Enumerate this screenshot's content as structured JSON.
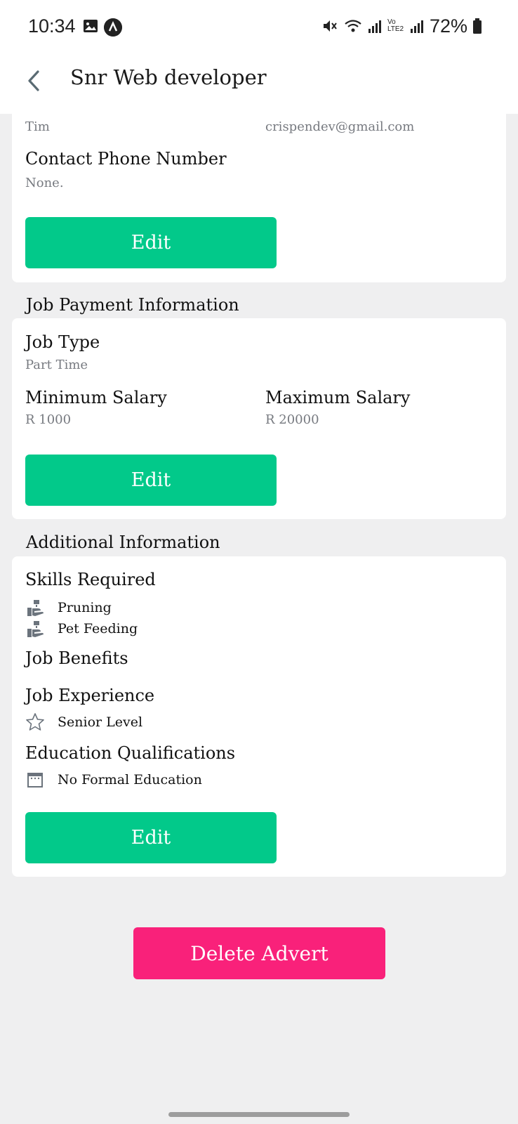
{
  "status_bar": {
    "time": "10:34",
    "battery": "72%",
    "network_label": "Vo LTE2"
  },
  "header": {
    "title": "Snr Web developer",
    "back_icon": "chevron-left-icon"
  },
  "contact_card": {
    "name": "Tim",
    "email": "crispendev@gmail.com",
    "phone_label": "Contact Phone Number",
    "phone_value": "None.",
    "edit_label": "Edit"
  },
  "payment": {
    "heading": "Job Payment Information",
    "job_type_label": "Job Type",
    "job_type_value": "Part Time",
    "min_salary_label": "Minimum Salary",
    "min_salary_value": "R 1000",
    "max_salary_label": "Maximum Salary",
    "max_salary_value": "R 20000",
    "edit_label": "Edit"
  },
  "additional": {
    "heading": "Additional Information",
    "skills_label": "Skills Required",
    "skills": [
      "Pruning",
      "Pet Feeding"
    ],
    "benefits_label": "Job Benefits",
    "experience_label": "Job Experience",
    "experience_value": "Senior Level",
    "education_label": "Education Qualifications",
    "education_value": "No Formal Education",
    "edit_label": "Edit"
  },
  "delete_label": "Delete Advert",
  "colors": {
    "accent_green": "#02c98a",
    "delete_pink": "#f9217a",
    "background": "#efeff0"
  }
}
